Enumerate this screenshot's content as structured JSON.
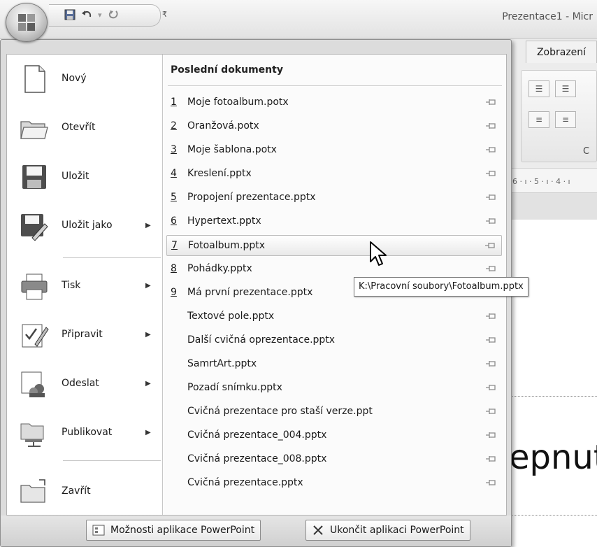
{
  "window": {
    "title": "Prezentace1 - Micr",
    "active_tab": "Zobrazení",
    "ruler_text": "6 · ı · 5 · ı · 4 · ı",
    "slide_text": "epnut"
  },
  "quick_access": {
    "icons": [
      "save-icon",
      "undo-icon",
      "dropdown-icon",
      "redo-icon",
      "customize-icon"
    ],
    "customize_glyph": "₹"
  },
  "ribbon": {
    "group_label": "C"
  },
  "menu": {
    "left_items": [
      {
        "label": "Nový",
        "icon": "new-document-icon",
        "has_submenu": false
      },
      {
        "label": "Otevřít",
        "icon": "open-folder-icon",
        "has_submenu": false
      },
      {
        "label": "Uložit",
        "icon": "save-disk-icon",
        "has_submenu": false
      },
      {
        "label": "Uložit jako",
        "icon": "save-as-icon",
        "has_submenu": true
      },
      {
        "label": "Tisk",
        "icon": "printer-icon",
        "has_submenu": true
      },
      {
        "label": "Připravit",
        "icon": "prepare-icon",
        "has_submenu": true
      },
      {
        "label": "Odeslat",
        "icon": "send-icon",
        "has_submenu": true
      },
      {
        "label": "Publikovat",
        "icon": "publish-icon",
        "has_submenu": true
      },
      {
        "label": "Zavřít",
        "icon": "close-folder-icon",
        "has_submenu": false
      }
    ],
    "submenu_arrow": "▶",
    "recent": {
      "title": "Poslední dokumenty",
      "items": [
        {
          "num": "1",
          "name": "Moje fotoalbum.potx"
        },
        {
          "num": "2",
          "name": "Oranžová.potx"
        },
        {
          "num": "3",
          "name": "Moje šablona.potx"
        },
        {
          "num": "4",
          "name": "Kreslení.pptx"
        },
        {
          "num": "5",
          "name": "Propojení prezentace.pptx"
        },
        {
          "num": "6",
          "name": "Hypertext.pptx"
        },
        {
          "num": "7",
          "name": "Fotoalbum.pptx"
        },
        {
          "num": "8",
          "name": "Pohádky.pptx"
        },
        {
          "num": "9",
          "name": "Má první prezentace.pptx"
        },
        {
          "num": "",
          "name": "Textové pole.pptx"
        },
        {
          "num": "",
          "name": "Další cvičná oprezentace.pptx"
        },
        {
          "num": "",
          "name": "SamrtArt.pptx"
        },
        {
          "num": "",
          "name": "Pozadí snímku.pptx"
        },
        {
          "num": "",
          "name": "Cvičná prezentace pro staší verze.ppt"
        },
        {
          "num": "",
          "name": "Cvičná prezentace_004.pptx"
        },
        {
          "num": "",
          "name": "Cvičná prezentace_008.pptx"
        },
        {
          "num": "",
          "name": "Cvičná prezentace.pptx"
        }
      ],
      "highlighted": "Fotoalbum.pptx"
    },
    "tooltip": "K:\\Pracovní soubory\\Fotoalbum.pptx",
    "bottom": {
      "options_label": "Možnosti aplikace PowerPoint",
      "exit_label": "Ukončit aplikaci PowerPoint"
    }
  }
}
